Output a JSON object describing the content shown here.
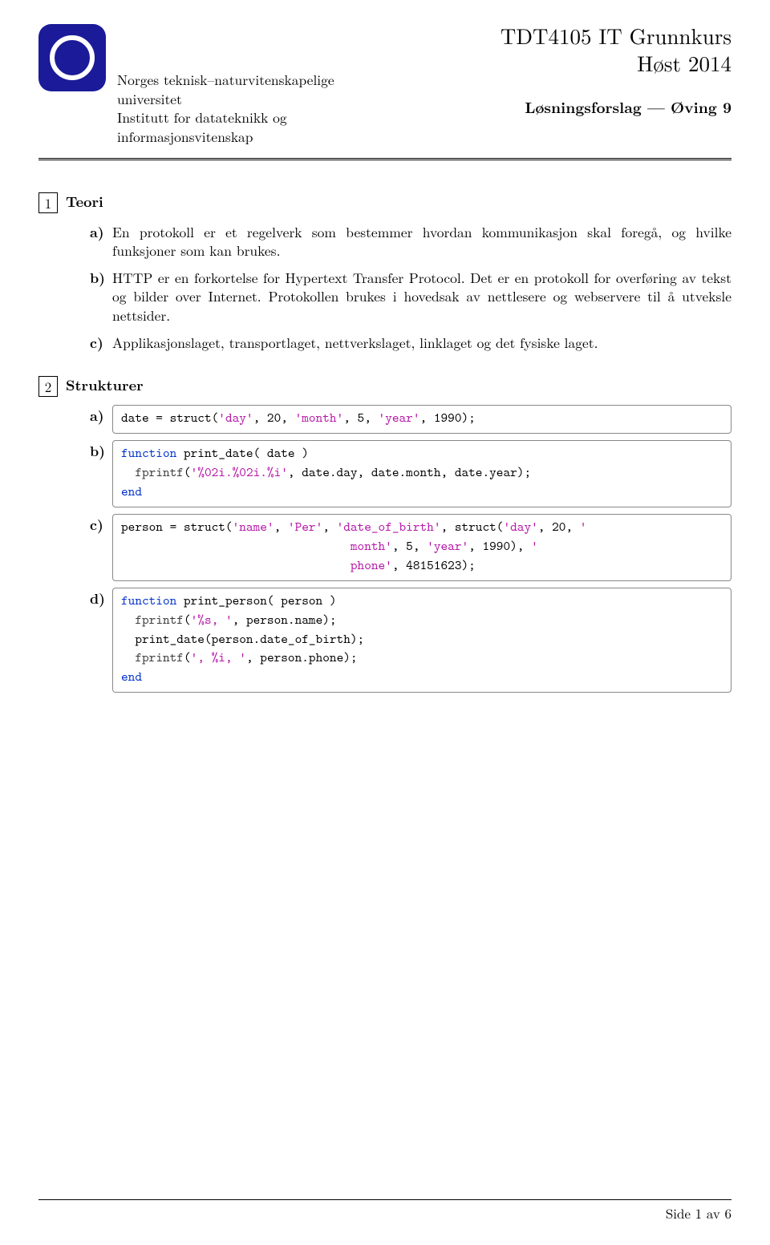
{
  "header": {
    "course_title": "TDT4105 IT Grunnkurs",
    "semester": "Høst 2014",
    "subtitle": "Løsningsforslag — Øving 9",
    "institution_line1": "Norges teknisk–naturvitenskapelige",
    "institution_line2": "universitet",
    "institution_line3": "Institutt for datateknikk og",
    "institution_line4": "informasjonsvitenskap"
  },
  "sections": {
    "teori": {
      "num": "1",
      "title": "Teori",
      "items": {
        "a": "En protokoll er et regelverk som bestemmer hvordan kommunikasjon skal foregå, og hvilke funksjoner som kan brukes.",
        "b": "HTTP er en forkortelse for Hypertext Transfer Protocol. Det er en protokoll for overføring av tekst og bilder over Internet. Protokollen brukes i hovedsak av nettlesere og webservere til å utveksle nettsider.",
        "c": "Applikasjonslaget, transportlaget, nettverkslaget, linklaget og det fysiske laget."
      }
    },
    "strukturer": {
      "num": "2",
      "title": "Strukturer",
      "code_a": {
        "l1a": "date = struct(",
        "l1s1": "'day'",
        "l1b": ", 20, ",
        "l1s2": "'month'",
        "l1c": ", 5, ",
        "l1s3": "'year'",
        "l1d": ", 1990);"
      },
      "code_b": {
        "kw_fn": "function",
        "sig": " print_date( date )",
        "indent": "  ",
        "fp": "fprintf",
        "lp": "(",
        "s1": "'%02i.%02i.%i'",
        "rest": ", date.day, date.month, date.year);",
        "kw_end": "end"
      },
      "code_c": {
        "l1a": "person = struct(",
        "s1": "'name'",
        "l1b": ", ",
        "s2": "'Per'",
        "l1c": ", ",
        "s3": "'date_of_birth'",
        "l1d": ", struct(",
        "s4": "'day'",
        "l1e": ", 20, ",
        "s5": "'",
        "pad2": "                                 ",
        "s6": "month'",
        "l2a": ", 5, ",
        "s7": "'year'",
        "l2b": ", 1990), ",
        "s8": "'",
        "pad3": "                                 ",
        "s9": "phone'",
        "l3a": ", 48151623);"
      },
      "code_d": {
        "kw_fn": "function",
        "sig": " print_person( person )",
        "indent": "  ",
        "fp": "fprintf",
        "lp": "(",
        "s1": "'%s, '",
        "r1": ", person.name);",
        "pd": "print_date(person.date_of_birth);",
        "s2": "', %i, '",
        "r2": ", person.phone);",
        "kw_end": "end"
      }
    }
  },
  "labels": {
    "a": "a)",
    "b": "b)",
    "c": "c)",
    "d": "d)"
  },
  "footer": "Side 1 av 6"
}
